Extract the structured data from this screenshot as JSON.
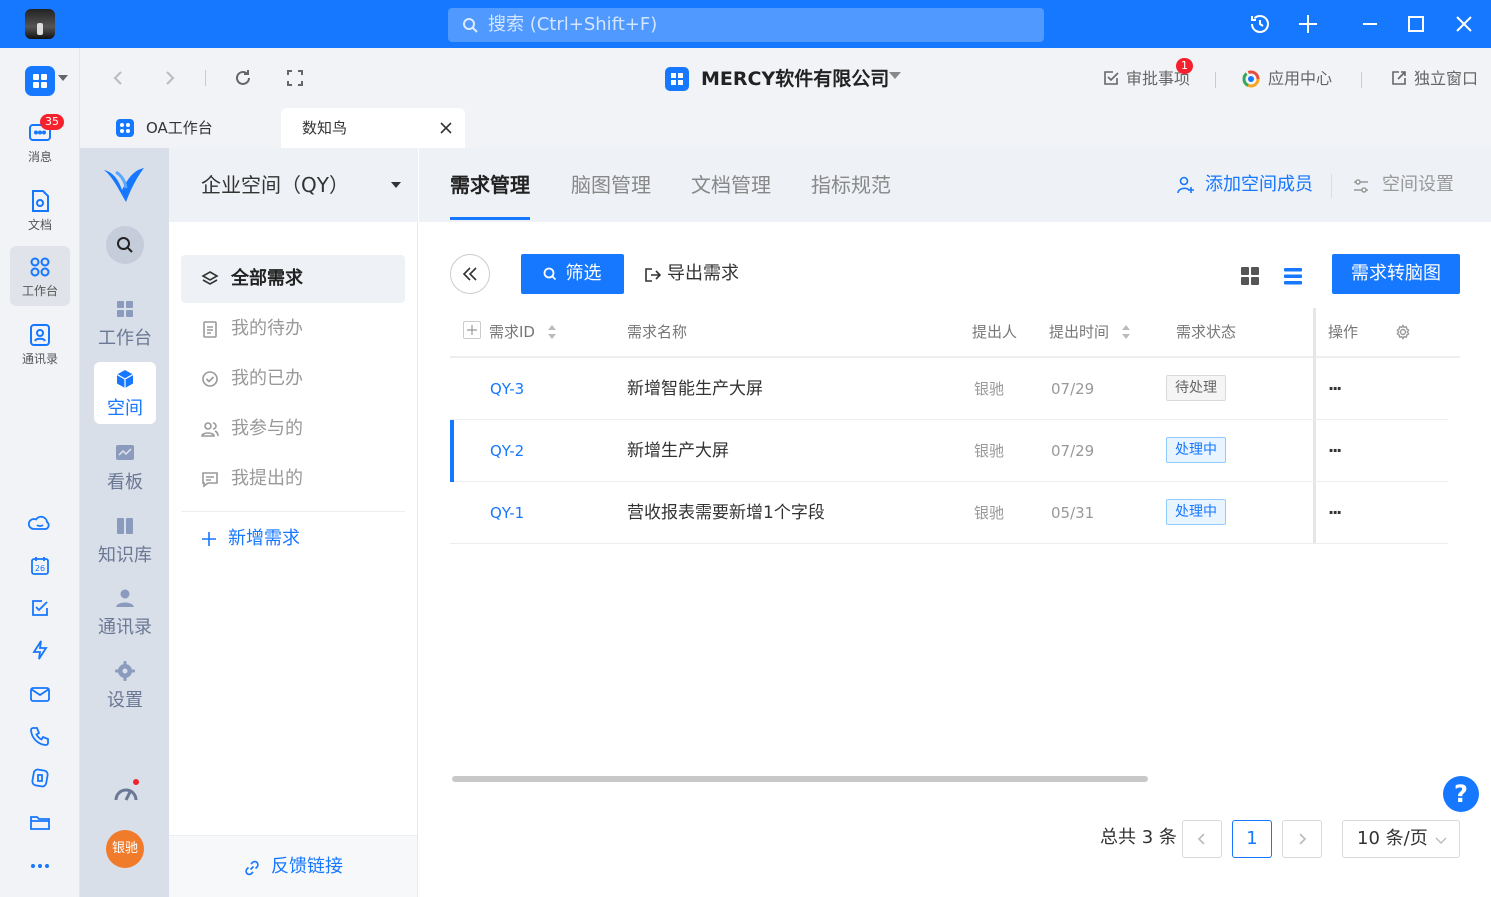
{
  "titlebar": {
    "search_placeholder": "搜索 (Ctrl+Shift+F)"
  },
  "leftbar": {
    "items": [
      {
        "label": "消息",
        "badge": "35"
      },
      {
        "label": "文档"
      },
      {
        "label": "工作台"
      },
      {
        "label": "通讯录"
      }
    ]
  },
  "topbar": {
    "company": "MERCY软件有限公司",
    "approval": "审批事项",
    "approval_badge": "1",
    "app_center": "应用中心",
    "standalone": "独立窗口"
  },
  "tabs": [
    {
      "label": "OA工作台"
    },
    {
      "label": "数知鸟"
    }
  ],
  "nav2": {
    "items": [
      {
        "label": "工作台"
      },
      {
        "label": "空间"
      },
      {
        "label": "看板"
      },
      {
        "label": "知识库"
      },
      {
        "label": "通讯录"
      },
      {
        "label": "设置"
      }
    ],
    "avatar": "银驰"
  },
  "sidebar": {
    "space": "企业空间（QY）",
    "items": [
      {
        "label": "全部需求"
      },
      {
        "label": "我的待办"
      },
      {
        "label": "我的已办"
      },
      {
        "label": "我参与的"
      },
      {
        "label": "我提出的"
      }
    ],
    "add": "新增需求",
    "feedback": "反馈链接"
  },
  "content": {
    "tabs": [
      {
        "label": "需求管理"
      },
      {
        "label": "脑图管理"
      },
      {
        "label": "文档管理"
      },
      {
        "label": "指标规范"
      }
    ],
    "add_member": "添加空间成员",
    "settings": "空间设置",
    "filter": "筛选",
    "export": "导出需求",
    "to_mindmap": "需求转脑图"
  },
  "table": {
    "headers": {
      "id": "需求ID",
      "name": "需求名称",
      "proposer": "提出人",
      "time": "提出时间",
      "status": "需求状态",
      "ops": "操作"
    },
    "rows": [
      {
        "id": "QY-3",
        "name": "新增智能生产大屏",
        "proposer": "银驰",
        "time": "07/29",
        "status": "待处理",
        "ops": "···"
      },
      {
        "id": "QY-2",
        "name": "新增生产大屏",
        "proposer": "银驰",
        "time": "07/29",
        "status": "处理中",
        "ops": "···"
      },
      {
        "id": "QY-1",
        "name": "营收报表需要新增1个字段",
        "proposer": "银驰",
        "time": "05/31",
        "status": "处理中",
        "ops": "···"
      }
    ]
  },
  "pagination": {
    "total": "总共 3 条",
    "page": "1",
    "page_size": "10 条/页"
  },
  "help": "?"
}
